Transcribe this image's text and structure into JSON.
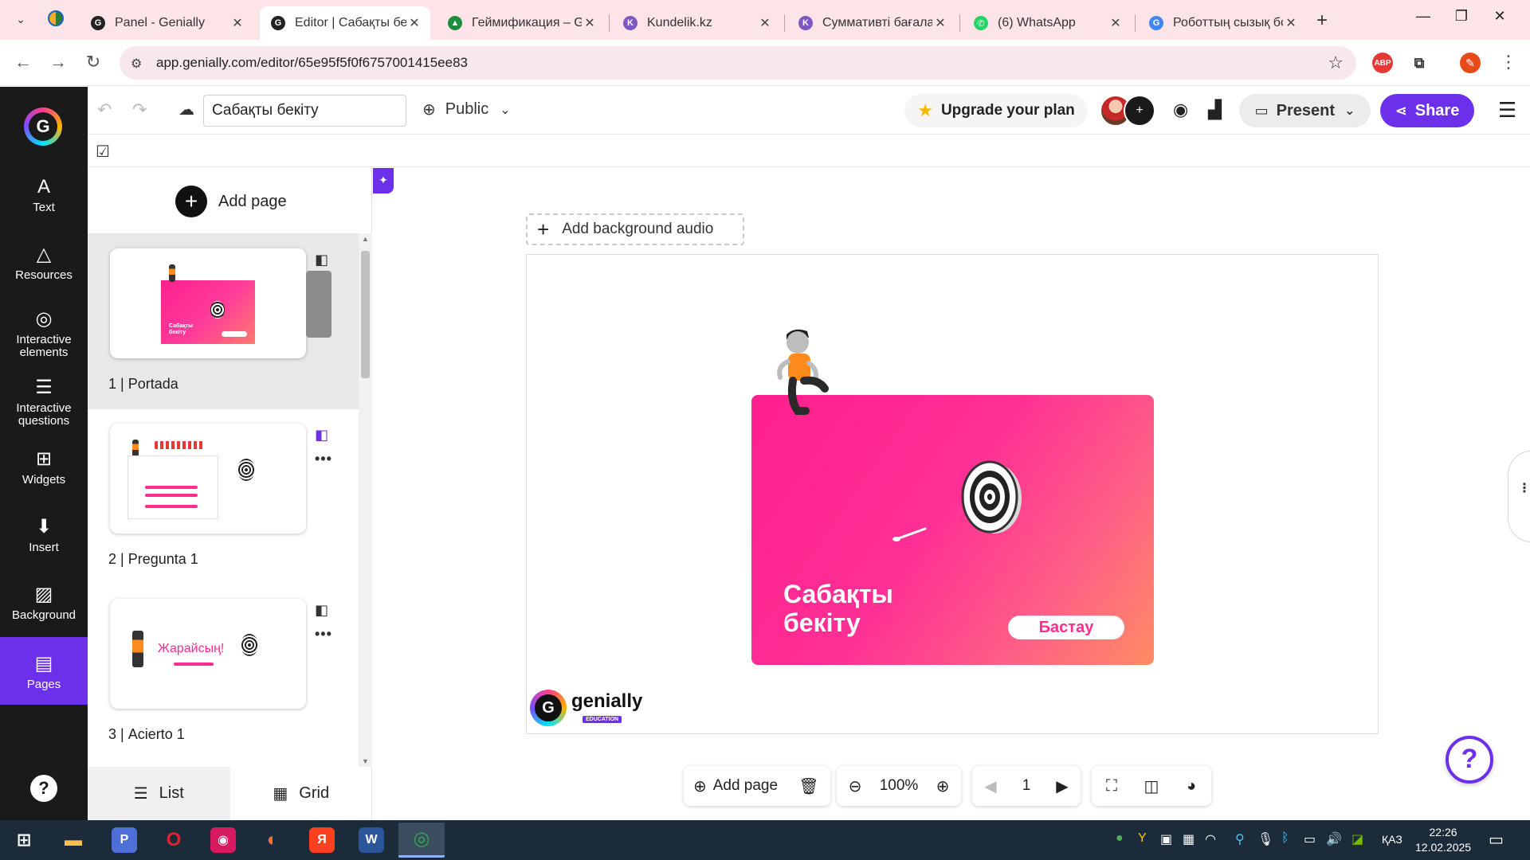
{
  "browser": {
    "tabs": [
      {
        "label": "Panel - Genially",
        "favicon": "genially-icon",
        "fav_text": "G",
        "fav_color": "#222222"
      },
      {
        "label": "Editor | Сабақты бе",
        "favicon": "genially-icon",
        "fav_text": "G",
        "fav_color": "#222222"
      },
      {
        "label": "Геймификация – G",
        "favicon": "google-drive-icon",
        "fav_text": "▲",
        "fav_color": "#1e8e3e"
      },
      {
        "label": "Kundelik.kz",
        "favicon": "kundelik-icon",
        "fav_text": "K",
        "fav_color": "#7e57c2"
      },
      {
        "label": "Суммативті бағала",
        "favicon": "kundelik-icon",
        "fav_text": "K",
        "fav_color": "#7e57c2"
      },
      {
        "label": "(6) WhatsApp",
        "favicon": "whatsapp-icon",
        "fav_text": "✆",
        "fav_color": "#25d366"
      },
      {
        "label": "Роботтың сызық бо",
        "favicon": "google-icon",
        "fav_text": "G",
        "fav_color": "#4285f4"
      }
    ],
    "close_glyph": "✕",
    "new_tab_glyph": "+",
    "url": "app.genially.com/editor/65e95f5f0f6757001415ee83",
    "extensions": [
      {
        "name": "adblock-icon",
        "text": "ABP",
        "color": "#e53935"
      },
      {
        "name": "puzzle-icon",
        "text": "⧉",
        "color": "#ffffff"
      },
      {
        "name": "profile-icon",
        "text": "✎",
        "color": "#e64a19"
      }
    ]
  },
  "rail": {
    "items": [
      {
        "label": "Text",
        "icon": "A"
      },
      {
        "label": "Resources",
        "icon": "△"
      },
      {
        "label": "Interactive elements",
        "icon": "◎"
      },
      {
        "label": "Interactive questions",
        "icon": "☰"
      },
      {
        "label": "Widgets",
        "icon": "⊞"
      },
      {
        "label": "Insert",
        "icon": "⬇"
      },
      {
        "label": "Background",
        "icon": "▨"
      },
      {
        "label": "Pages",
        "icon": "▤"
      }
    ],
    "active": "Pages",
    "help": "?"
  },
  "toolbar": {
    "title_value": "Сабақты бекіту",
    "visibility": "Public",
    "upgrade_label": "Upgrade your plan",
    "present_label": "Present",
    "share_label": "Share"
  },
  "pages_panel": {
    "add_page_label": "Add page",
    "pages": [
      {
        "number": "1 |",
        "name": "Portada",
        "selected": true
      },
      {
        "number": "2 |",
        "name": "Pregunta 1",
        "selected": false
      },
      {
        "number": "3 |",
        "name": "Acierto 1",
        "selected": false
      }
    ],
    "thumb_texts": {
      "cover_title": "Сабақты бекіту",
      "praise": "Жарайсың!"
    },
    "view_list_label": "List",
    "view_grid_label": "Grid"
  },
  "canvas": {
    "bg_audio_label": "Add background audio",
    "slide_title": "Сабақты бекіту",
    "start_button": "Бастау",
    "brand_name": "genially",
    "brand_tag": "EDUCATION",
    "colors": {
      "accent": "#6c30ea",
      "pink": "#ff2d8f"
    }
  },
  "bottom_toolbar": {
    "add_page_label": "Add page",
    "zoom": "100%",
    "current_page": "1"
  },
  "taskbar": {
    "apps": [
      {
        "name": "file-explorer-icon",
        "text": "▬",
        "color": "#f2c14e"
      },
      {
        "name": "p-app-icon",
        "text": "P",
        "color": "#4f6fd8"
      },
      {
        "name": "opera-icon",
        "text": "O",
        "color": "#e0242f"
      },
      {
        "name": "screen-recorder-icon",
        "text": "◉",
        "color": "#d81b60"
      },
      {
        "name": "firefox-icon",
        "text": "◐",
        "color": "#ff7139"
      },
      {
        "name": "yandex-icon",
        "text": "Я",
        "color": "#fc3f1d"
      },
      {
        "name": "word-icon",
        "text": "W",
        "color": "#2b579a"
      },
      {
        "name": "chrome-icon",
        "text": "◎",
        "color": "#34a853"
      }
    ],
    "language": "ҚАЗ",
    "time": "22:26",
    "date": "12.02.2025"
  }
}
